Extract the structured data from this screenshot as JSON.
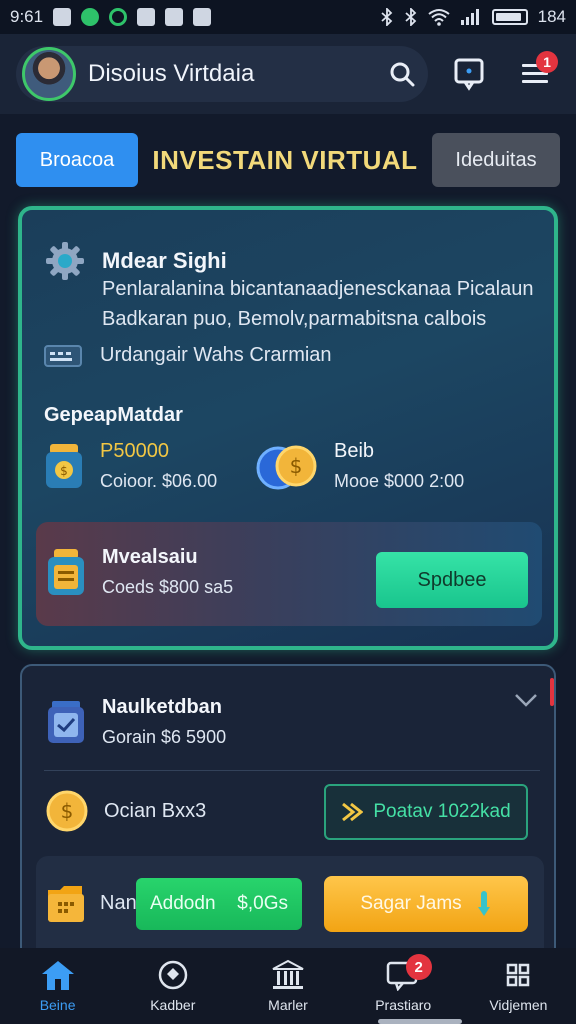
{
  "status_bar": {
    "time": "9:61",
    "battery": "184"
  },
  "header": {
    "profile_name": "Disoius Virtdaia",
    "notification_count": "1"
  },
  "tabs": {
    "primary": "Broacoa",
    "title": "INVESTAIN VIRTUAL",
    "secondary": "Ideduitas"
  },
  "main_card": {
    "title": "Mdear Sighi",
    "description_line1": "Penlaralanina bicantanaadjenesckanaa Picalaun",
    "description_line2": "Badkaran puo, Bemolv,parmabitsna calbois",
    "subtitle": "Urdangair Wahs Crarmian",
    "section_label": "GepeapMatdar",
    "stat_left": {
      "amount": "P50000",
      "sub": "Coioor. $06.00"
    },
    "stat_right": {
      "amount": "Beib",
      "sub": "Mooe $000 2:00"
    },
    "inner": {
      "title": "Mvealsaiu",
      "sub": "Coeds $800 sa5",
      "button": "Spdbee"
    }
  },
  "second_card": {
    "title": "Naulketdban",
    "sub": "Gorain $6 5900",
    "coin_label": "Ocian Bxx3",
    "outline_button": "Poatav 1022kad",
    "row_label": "Nan",
    "green_pill_left": "Addodn",
    "green_pill_right": "$,0Gs",
    "orange_button": "Sagar Jams"
  },
  "bottom_nav": {
    "items": [
      {
        "label": "Beine"
      },
      {
        "label": "Kadber"
      },
      {
        "label": "Marler"
      },
      {
        "label": "Prastiaro",
        "badge": "2"
      },
      {
        "label": "Vidjemen"
      }
    ]
  },
  "colors": {
    "accent_blue": "#2f8ff0",
    "accent_green": "#2fb58b",
    "title_gold": "#f2d97a",
    "badge_red": "#e3343f",
    "button_orange": "#f2a414"
  }
}
